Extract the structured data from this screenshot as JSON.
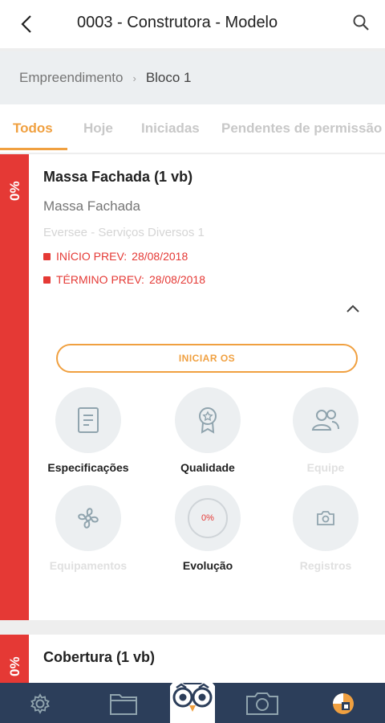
{
  "header": {
    "title": "0003 - Construtora - Modelo"
  },
  "breadcrumb": {
    "root": "Empreendimento",
    "separator": "›",
    "current": "Bloco 1"
  },
  "tabs": [
    {
      "label": "Todos",
      "active": true
    },
    {
      "label": "Hoje",
      "active": false
    },
    {
      "label": "Iniciadas",
      "active": false
    },
    {
      "label": "Pendentes de permissão",
      "active": false
    }
  ],
  "card": {
    "percent": "0%",
    "title": "Massa Fachada (1 vb)",
    "subtitle": "Massa Fachada",
    "provider": "Eversee - Serviços Diversos 1",
    "start_label": "INÍCIO PREV:",
    "start_date": "28/08/2018",
    "end_label": "TÉRMINO PREV:",
    "end_date": "28/08/2018",
    "start_button": "INICIAR OS",
    "actions": [
      {
        "label": "Especificações",
        "icon": "document-icon",
        "enabled": true
      },
      {
        "label": "Qualidade",
        "icon": "award-icon",
        "enabled": true
      },
      {
        "label": "Equipe",
        "icon": "team-icon",
        "enabled": false
      },
      {
        "label": "Equipamentos",
        "icon": "fan-icon",
        "enabled": false
      },
      {
        "label": "Evolução",
        "icon": "progress-ring-icon",
        "enabled": true,
        "value": "0%"
      },
      {
        "label": "Registros",
        "icon": "camera-icon",
        "enabled": false
      }
    ]
  },
  "card2": {
    "percent": "0%",
    "title": "Cobertura (1 vb)"
  },
  "colors": {
    "accent": "#f0a040",
    "status_red": "#e53935",
    "bottom_bar": "#2c3e5a"
  }
}
